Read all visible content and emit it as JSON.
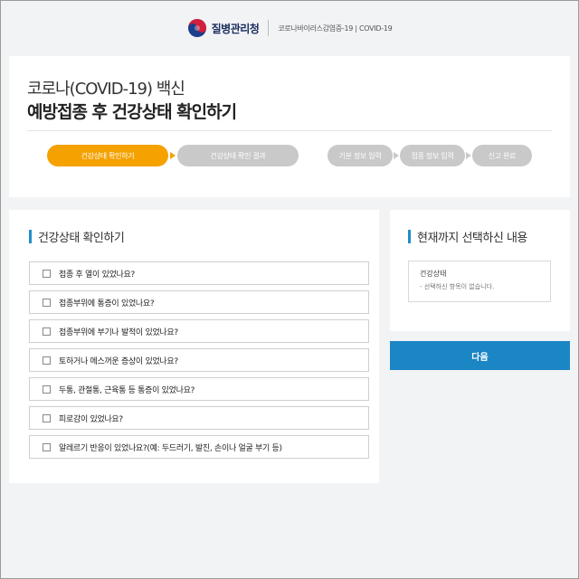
{
  "header": {
    "agency_name": "질병관리청",
    "subtitle": "코로나바이러스감염증-19 | COVID-19"
  },
  "page": {
    "title_line1": "코로나(COVID-19) 백신",
    "title_line2": "예방접종 후 건강상태 확인하기"
  },
  "steps": [
    {
      "label": "건강상태 확인하기",
      "active": true
    },
    {
      "label": "건강상태 확인 결과",
      "active": false
    },
    {
      "label": "기본 정보 입력",
      "active": false
    },
    {
      "label": "접종 정보 입력",
      "active": false
    },
    {
      "label": "신고 완료",
      "active": false
    }
  ],
  "checklist": {
    "title": "건강상태 확인하기",
    "items": [
      "접종 후 열이 있었나요?",
      "접종부위에 통증이 있었나요?",
      "접종부위에 부기나 발적이 있었나요?",
      "토하거나 메스꺼운 증상이 있었나요?",
      "두통, 관절통, 근육통 등 통증이 있었나요?",
      "피로감이 있었나요?",
      "알레르기 반응이 있었나요?(예: 두드러기, 발진, 손이나 얼굴 부기 등)"
    ]
  },
  "summary": {
    "title": "현재까지 선택하신 내용",
    "section_label": "건강상태",
    "empty_text": "- 선택하신 항목이 없습니다."
  },
  "actions": {
    "next_label": "다음"
  },
  "colors": {
    "accent_orange": "#f5a100",
    "accent_blue": "#1a86c4",
    "step_inactive": "#c9c9c9"
  }
}
